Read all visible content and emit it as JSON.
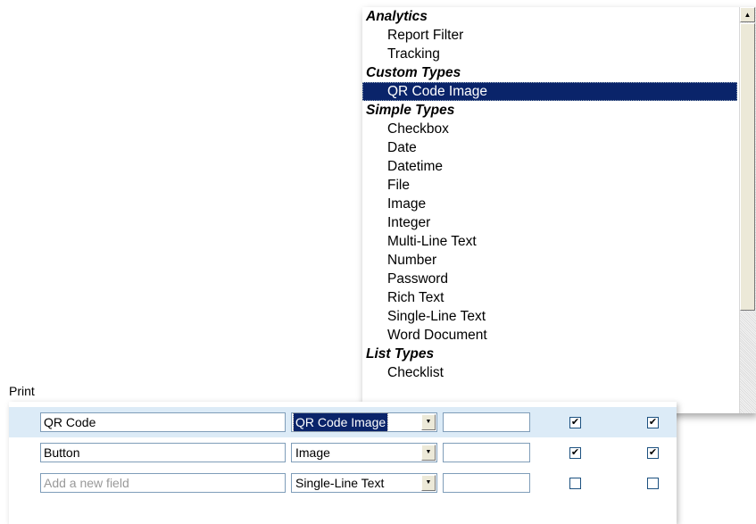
{
  "field_type_dropdown": {
    "groups": [
      {
        "label": "Analytics",
        "options": [
          "Report Filter",
          "Tracking"
        ]
      },
      {
        "label": "Custom Types",
        "options": [
          "QR Code Image"
        ]
      },
      {
        "label": "Simple Types",
        "options": [
          "Checkbox",
          "Date",
          "Datetime",
          "File",
          "Image",
          "Integer",
          "Multi-Line Text",
          "Number",
          "Password",
          "Rich Text",
          "Single-Line Text",
          "Word Document"
        ]
      },
      {
        "label": "List Types",
        "options": [
          "Checklist"
        ]
      }
    ],
    "selected": "QR Code Image",
    "scroll_up_icon": "arrow-up-icon"
  },
  "print_label": "Print",
  "rows": [
    {
      "name": "QR Code",
      "type": "QR Code Image",
      "extra": "",
      "check1": true,
      "check2": true,
      "highlight": true
    },
    {
      "name": "Button",
      "type": "Image",
      "extra": "",
      "check1": true,
      "check2": true,
      "highlight": false
    },
    {
      "name": "",
      "placeholder": "Add a new field",
      "type": "Single-Line Text",
      "extra": "",
      "check1": false,
      "check2": false,
      "highlight": false
    }
  ],
  "colors": {
    "selection": "#0a246a",
    "row_highlight": "#dcebf7",
    "input_border": "#7f9db9"
  }
}
